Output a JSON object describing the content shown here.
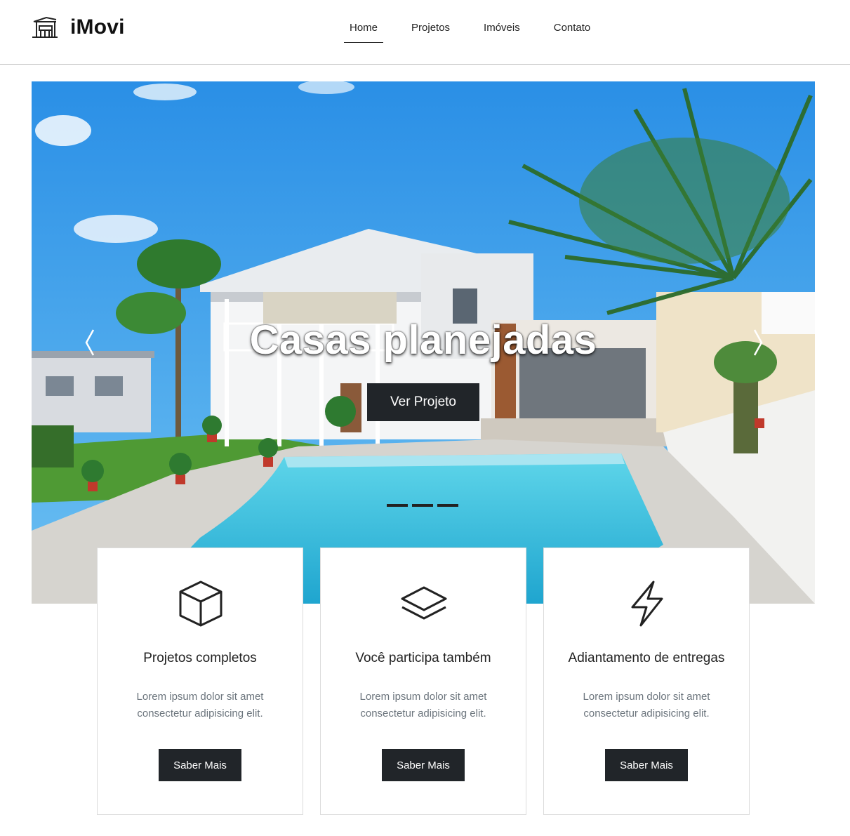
{
  "brand": {
    "name": "iMovi",
    "logo_icon": "house-building-icon"
  },
  "nav": {
    "items": [
      {
        "label": "Home",
        "active": true
      },
      {
        "label": "Projetos",
        "active": false
      },
      {
        "label": "Imóveis",
        "active": false
      },
      {
        "label": "Contato",
        "active": false
      }
    ]
  },
  "hero": {
    "title": "Casas planejadas",
    "button_label": "Ver Projeto",
    "prev_icon": "chevron-left-icon",
    "next_icon": "chevron-right-icon",
    "indicators_count": 3,
    "active_indicator": 0
  },
  "features": [
    {
      "icon": "box-icon",
      "title": "Projetos completos",
      "text": "Lorem ipsum dolor sit amet consectetur adipisicing elit.",
      "button_label": "Saber Mais"
    },
    {
      "icon": "layers-icon",
      "title": "Você participa também",
      "text": "Lorem ipsum dolor sit amet consectetur adipisicing elit.",
      "button_label": "Saber Mais"
    },
    {
      "icon": "lightning-icon",
      "title": "Adiantamento de entregas",
      "text": "Lorem ipsum dolor sit amet consectetur adipisicing elit.",
      "button_label": "Saber Mais"
    }
  ],
  "colors": {
    "dark_button": "#212529",
    "muted_text": "#6c757d",
    "sky": "#2f8fe8",
    "pool": "#3fc3e0"
  }
}
